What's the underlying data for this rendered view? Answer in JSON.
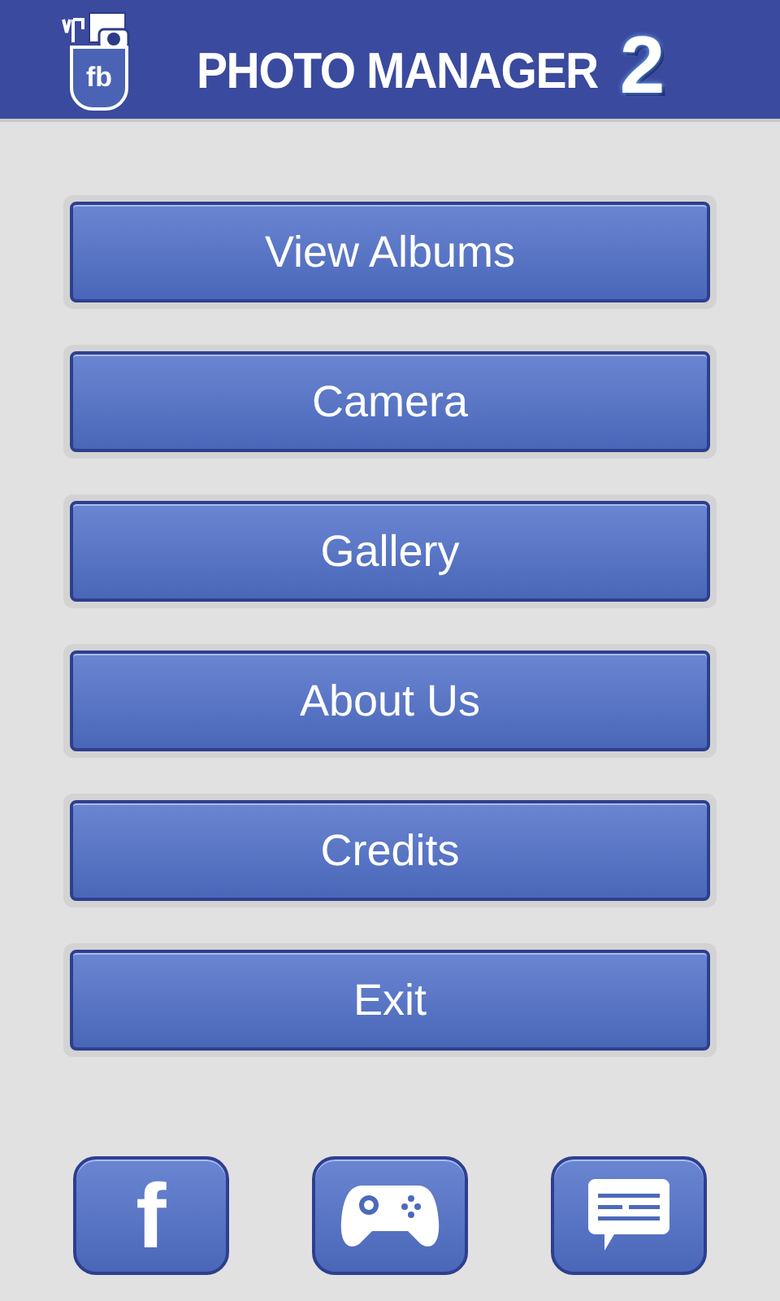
{
  "header": {
    "logo_text": "fb",
    "title": "PHOTO MANAGER",
    "version": "2"
  },
  "menu": [
    "View Albums",
    "Camera",
    "Gallery",
    "About Us",
    "Credits",
    "Exit"
  ],
  "bottom_buttons": [
    {
      "kind": "facebook",
      "label": "f"
    },
    {
      "kind": "game"
    },
    {
      "kind": "chat"
    }
  ]
}
